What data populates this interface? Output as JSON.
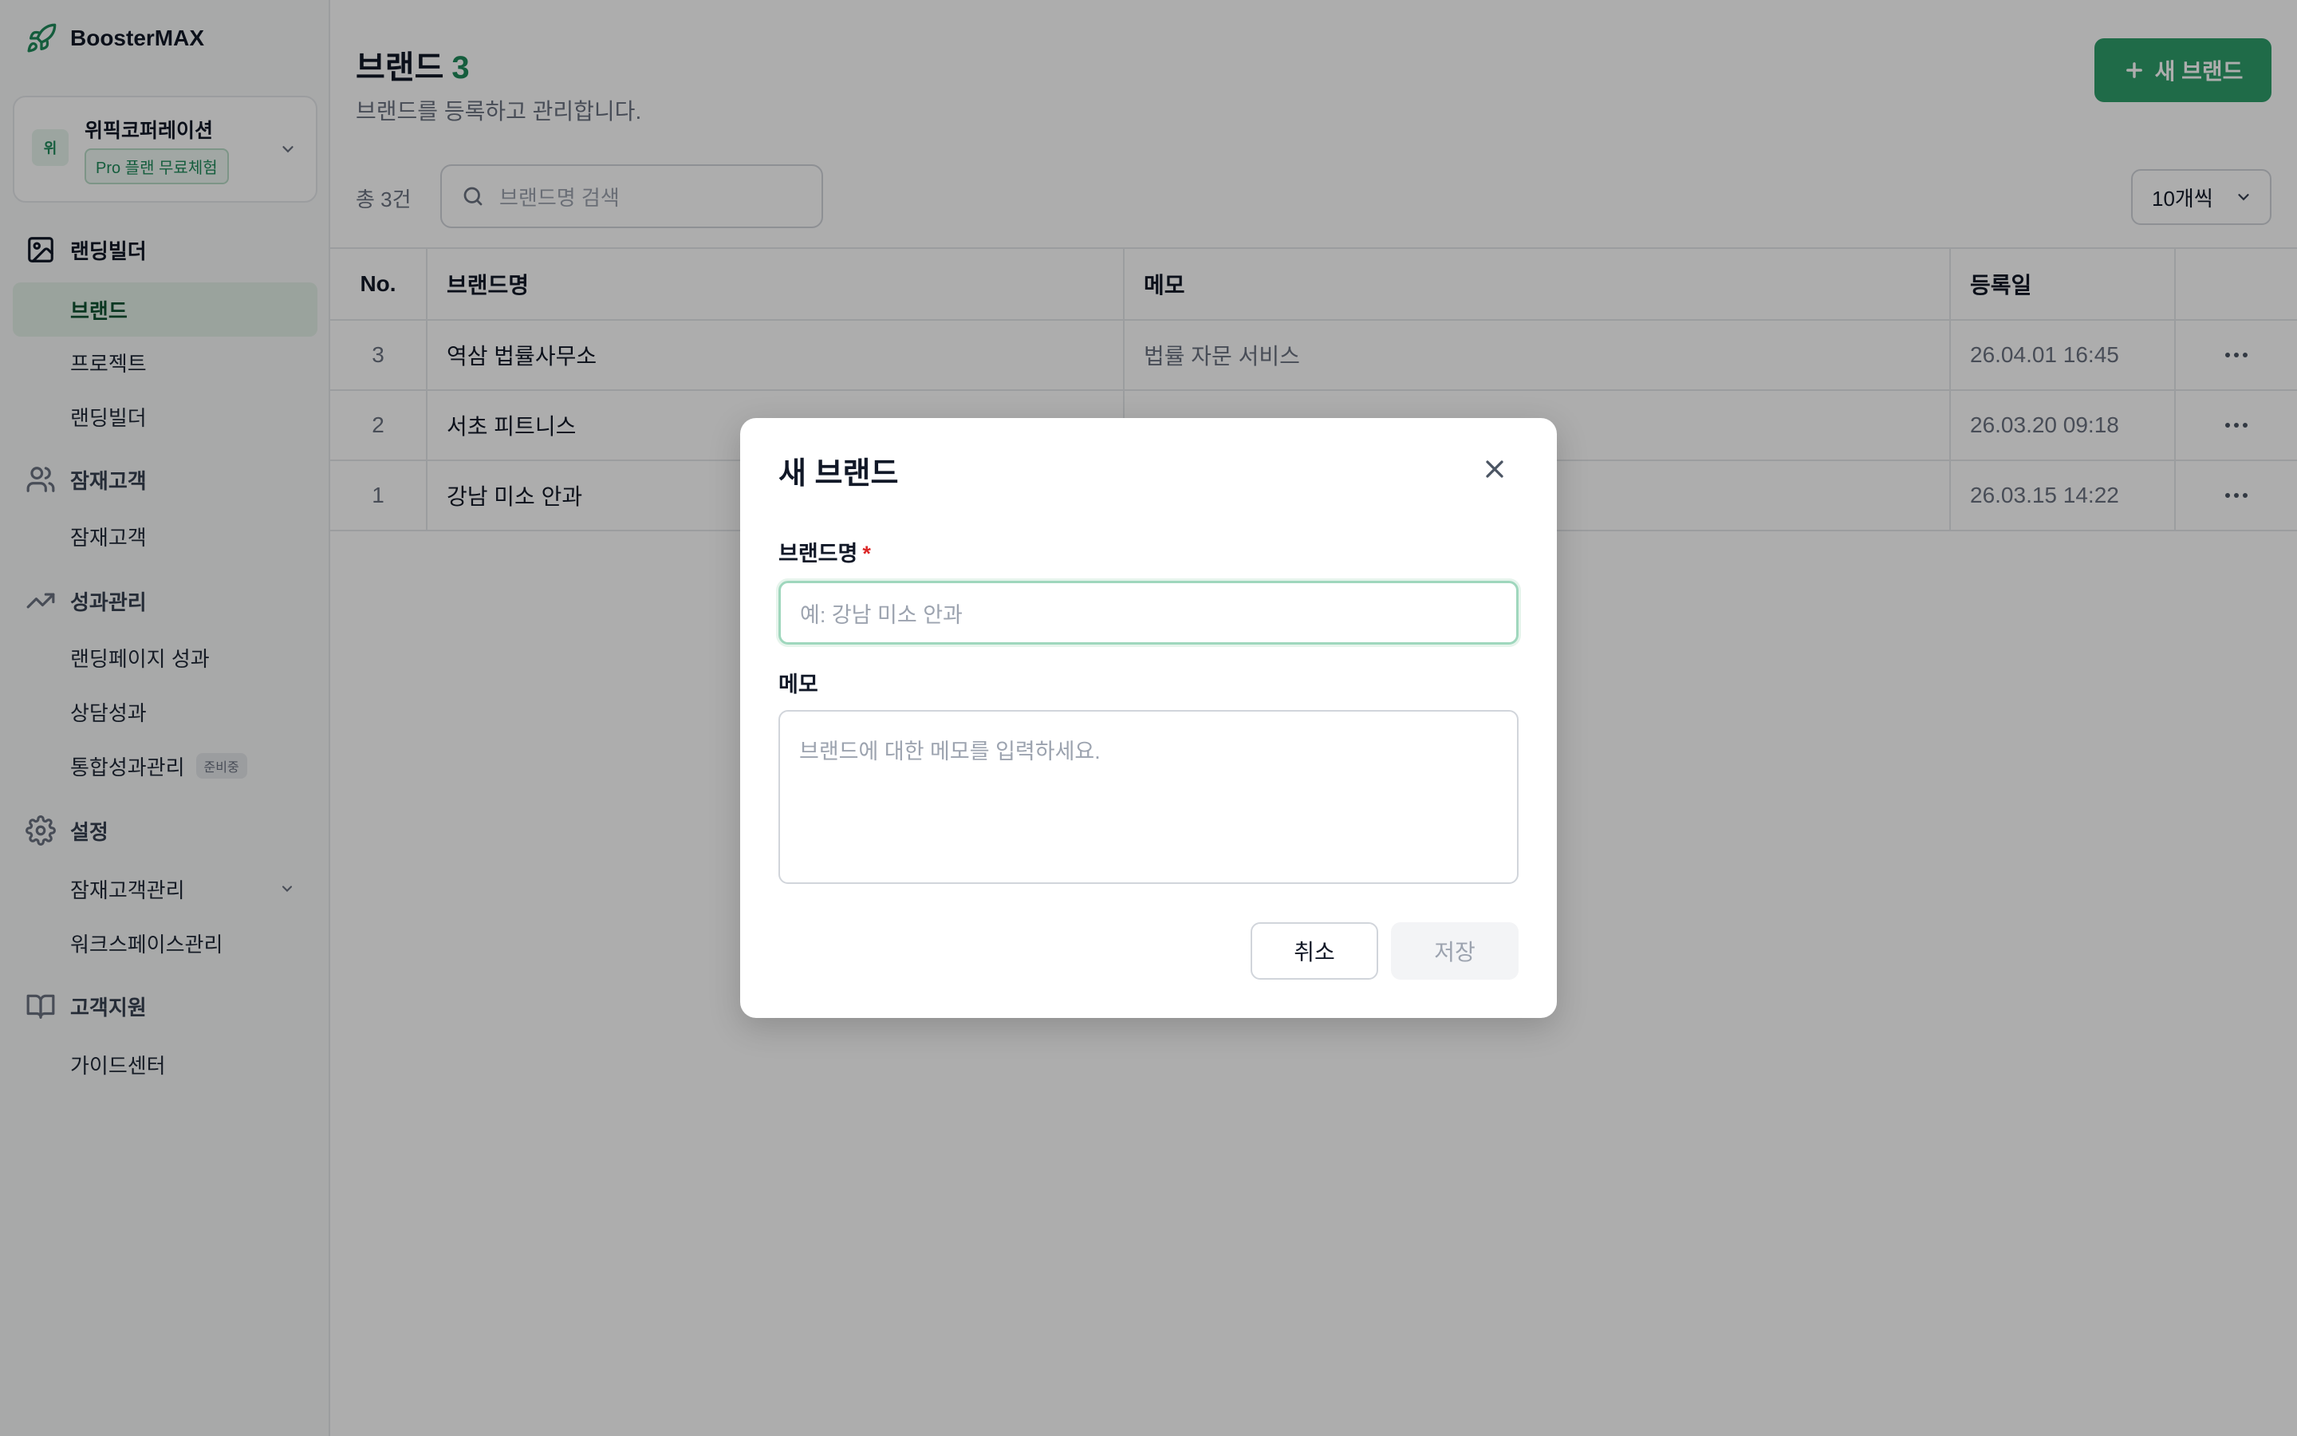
{
  "app": {
    "name": "BoosterMAX"
  },
  "workspace": {
    "avatar": "위",
    "name": "위픽코퍼레이션",
    "plan_badge": "Pro 플랜 무료체험"
  },
  "sidebar": {
    "groups": [
      {
        "label": "랜딩빌더",
        "icon": "image-icon"
      },
      {
        "label": "잠재고객",
        "icon": "users-icon"
      },
      {
        "label": "성과관리",
        "icon": "trending-up-icon"
      },
      {
        "label": "설정",
        "icon": "gear-icon"
      },
      {
        "label": "고객지원",
        "icon": "book-icon"
      }
    ],
    "items": [
      {
        "label": "브랜드",
        "active": true
      },
      {
        "label": "프로젝트"
      },
      {
        "label": "랜딩빌더"
      },
      {
        "label": "잠재고객"
      },
      {
        "label": "랜딩페이지 성과"
      },
      {
        "label": "상담성과"
      },
      {
        "label": "통합성과관리",
        "tag": "준비중"
      },
      {
        "label": "잠재고객관리"
      },
      {
        "label": "워크스페이스관리"
      },
      {
        "label": "가이드센터"
      }
    ]
  },
  "page": {
    "title": "브랜드",
    "count": "3",
    "subtitle": "브랜드를 등록하고 관리합니다.",
    "new_button": "새 브랜드",
    "total": "총 3건",
    "search_placeholder": "브랜드명 검색",
    "per_page": "10개씩"
  },
  "table": {
    "headers": [
      "No.",
      "브랜드명",
      "메모",
      "등록일",
      ""
    ],
    "rows": [
      {
        "no": "3",
        "name": "역삼 법률사무소",
        "memo": "법률 자문 서비스",
        "date": "26.04.01 16:45"
      },
      {
        "no": "2",
        "name": "서초 피트니스",
        "memo": "",
        "date": "26.03.20 09:18"
      },
      {
        "no": "1",
        "name": "강남 미소 안과",
        "memo": "",
        "date": "26.03.15 14:22"
      }
    ]
  },
  "modal": {
    "title": "새 브랜드",
    "name_label": "브랜드명",
    "required_mark": "*",
    "name_placeholder": "예: 강남 미소 안과",
    "memo_label": "메모",
    "memo_placeholder": "브랜드에 대한 메모를 입력하세요.",
    "cancel": "취소",
    "save": "저장"
  },
  "colors": {
    "accent": "#2e9e6b",
    "accent_text": "#1f8a5b",
    "active_bg": "#e3f1e8"
  }
}
